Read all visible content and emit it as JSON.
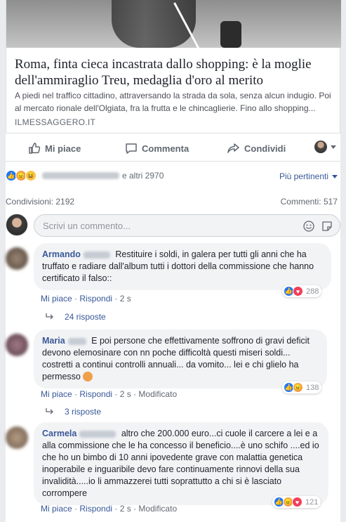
{
  "article": {
    "title": "Roma, finta cieca incastrata dallo shopping: è la moglie dell'ammiraglio Treu, medaglia d'oro al merito",
    "description": "A piedi nel traffico cittadino, attraversando la strada da sola, senza alcun indugio. Poi al mercato rionale dell'Olgiata, fra la frutta e le chincaglierie. Fino allo shopping...",
    "source": "ILMESSAGGERO.IT"
  },
  "actions": {
    "like": "Mi piace",
    "comment": "Commenta",
    "share": "Condividi"
  },
  "reactions_bar": {
    "others": "e altri 2970",
    "relevance": "Più pertinenti"
  },
  "stats": {
    "shares": "Condivisioni: 2192",
    "comments": "Commenti: 517"
  },
  "composer": {
    "placeholder": "Scrivi un commento..."
  },
  "comments": [
    {
      "author": "Armando",
      "text": "Restituire i soldi, in galera per tutti gli anni che ha truffato e radiare dall'album tutti i dottori della commissione che hanno certificato il falso::",
      "like": "Mi piace",
      "reply": "Rispondi",
      "time": "2 s",
      "reactions_count": "288",
      "replies": "24 risposte"
    },
    {
      "author": "Maria",
      "text": "E poi persone che effettivamente soffrono di gravi deficit devono elemosinare con nn poche difficoltà questi miseri soldi... costretti a continui controlli annuali... da vomito... lei e chi glielo ha permesso",
      "like": "Mi piace",
      "reply": "Rispondi",
      "time": "2 s",
      "modified": "Modificato",
      "reactions_count": "138",
      "replies": "3 risposte"
    },
    {
      "author": "Carmela",
      "text": "altro che 200.000 euro...ci cuole il carcere a lei e a alla commissione che le ha concesso il beneficio....è uno schifo ....ed io che ho un bimbo di 10 anni ipovedente grave con malattia genetica inoperabile e inguaribile devo fare continuamente rinnovi della sua invalidità.....io li ammazzerei tutti soprattutto a chi si è lasciato corrompere",
      "like": "Mi piace",
      "reply": "Rispondi",
      "time": "2 s",
      "modified": "Modificato",
      "reactions_count": "121"
    }
  ],
  "colors": {
    "link": "#385898",
    "like_blue": "#2078f4",
    "love_red": "#f33e58",
    "angry_orange": "#f0a04b"
  }
}
